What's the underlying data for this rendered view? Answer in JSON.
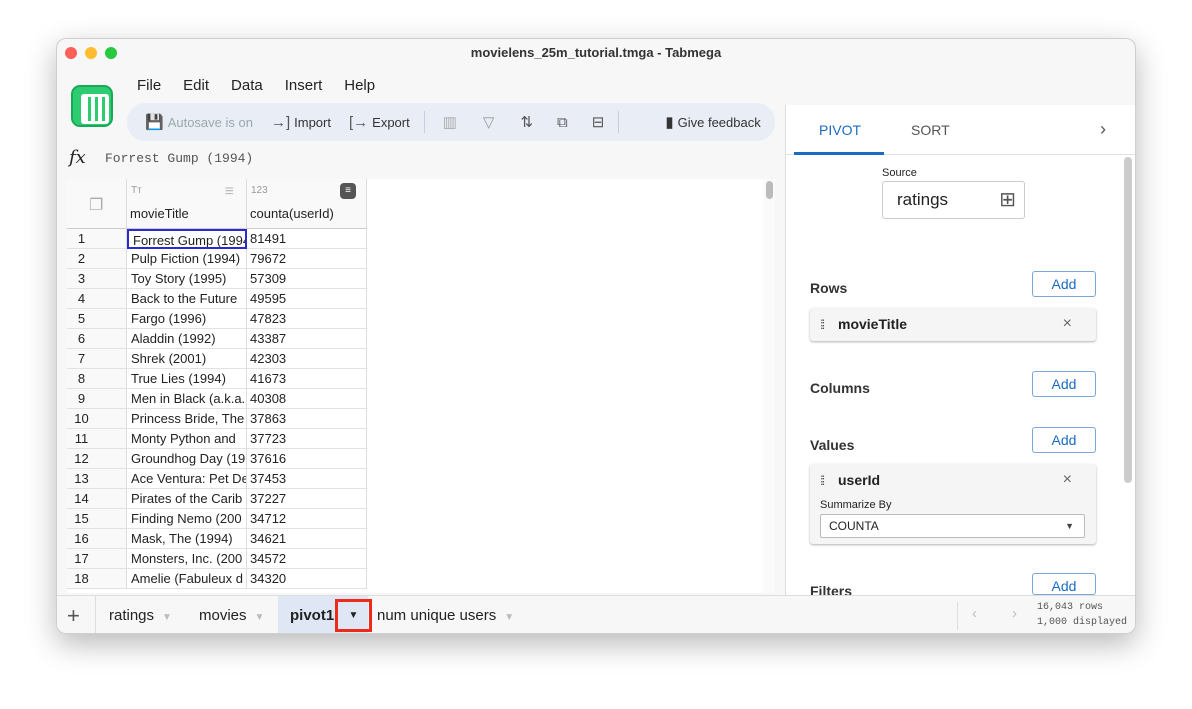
{
  "window": {
    "title": "movielens_25m_tutorial.tmga - Tabmega"
  },
  "menu": [
    "File",
    "Edit",
    "Data",
    "Insert",
    "Help"
  ],
  "toolbar": {
    "autosave": "Autosave is on",
    "import": "Import",
    "export": "Export",
    "feedback": "Give feedback"
  },
  "formula": {
    "value": "Forrest Gump (1994)"
  },
  "grid": {
    "columns": [
      {
        "type": "Tт",
        "name": "movieTitle"
      },
      {
        "type": "123",
        "name": "counta(userId)"
      }
    ],
    "rows": [
      [
        "1",
        "Forrest Gump (1994)",
        "81491"
      ],
      [
        "2",
        "Pulp Fiction (1994)",
        "79672"
      ],
      [
        "3",
        "Toy Story (1995)",
        "57309"
      ],
      [
        "4",
        "Back to the Future",
        "49595"
      ],
      [
        "5",
        "Fargo (1996)",
        "47823"
      ],
      [
        "6",
        "Aladdin (1992)",
        "43387"
      ],
      [
        "7",
        "Shrek (2001)",
        "42303"
      ],
      [
        "8",
        "True Lies (1994)",
        "41673"
      ],
      [
        "9",
        "Men in Black (a.k.a.",
        "40308"
      ],
      [
        "10",
        "Princess Bride, The",
        "37863"
      ],
      [
        "11",
        "Monty Python and",
        "37723"
      ],
      [
        "12",
        "Groundhog Day (19",
        "37616"
      ],
      [
        "13",
        "Ace Ventura: Pet De",
        "37453"
      ],
      [
        "14",
        "Pirates of the Carib",
        "37227"
      ],
      [
        "15",
        "Finding Nemo (200",
        "34712"
      ],
      [
        "16",
        "Mask, The (1994)",
        "34621"
      ],
      [
        "17",
        "Monsters, Inc. (200",
        "34572"
      ],
      [
        "18",
        "Amelie (Fabuleux d",
        "34320"
      ]
    ]
  },
  "panel": {
    "tabs": [
      "PIVOT",
      "SORT"
    ],
    "source_label": "Source",
    "source": "ratings",
    "rows_label": "Rows",
    "row_field": "movieTitle",
    "columns_label": "Columns",
    "values_label": "Values",
    "value_field": "userId",
    "summarize_label": "Summarize By",
    "summarize": "COUNTA",
    "filters_label": "Filters",
    "add": "Add"
  },
  "sheets": [
    "ratings",
    "movies",
    "pivot1",
    "num unique users"
  ],
  "status": {
    "rows": "16,043 rows",
    "displayed": "1,000 displayed"
  },
  "colors": {
    "accent": "#1a6bc4",
    "highlight": "#ee2a1a"
  }
}
